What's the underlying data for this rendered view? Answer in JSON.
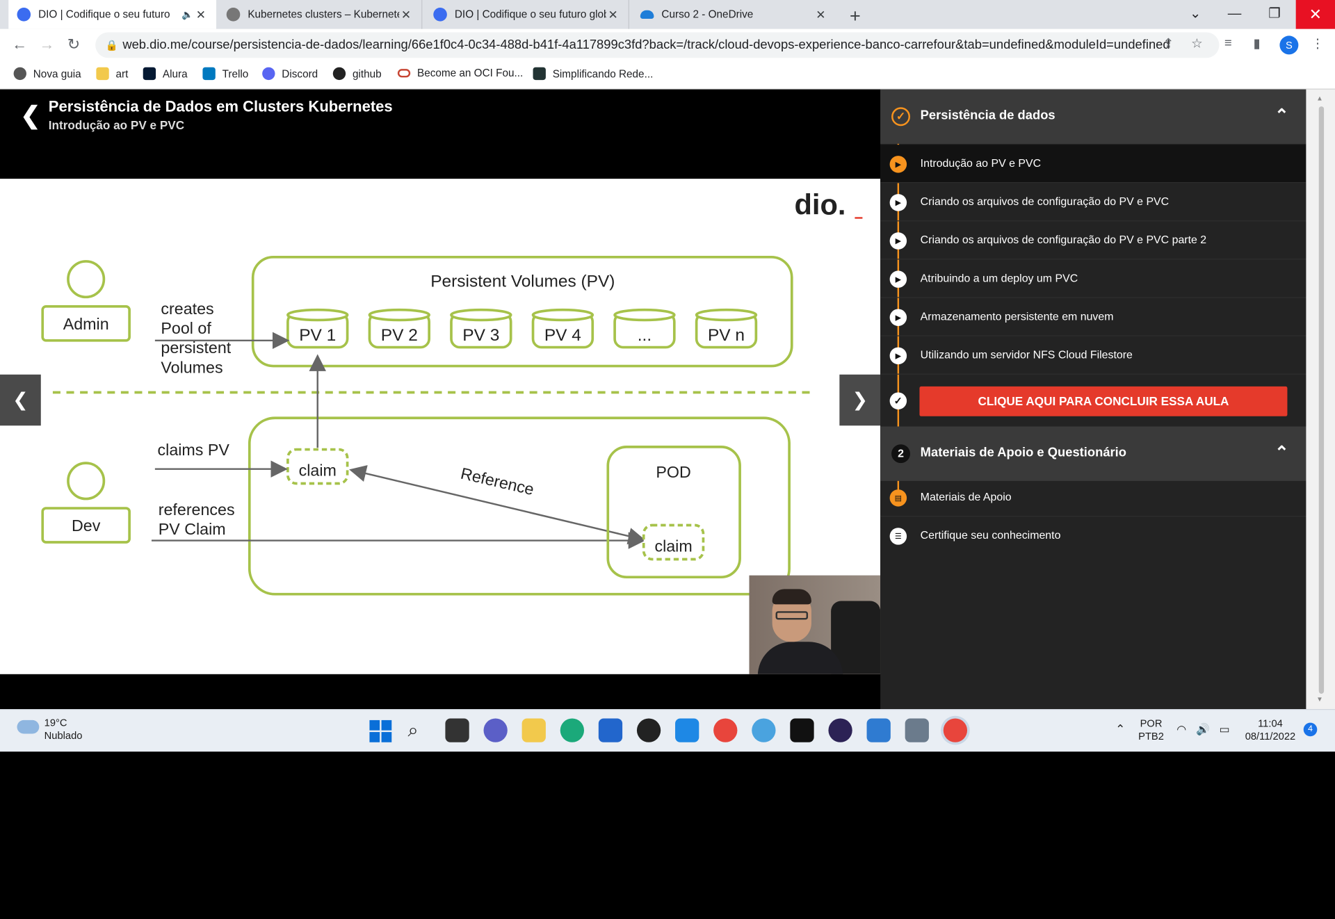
{
  "browser": {
    "tabs": [
      {
        "title": "DIO | Codifique o seu futuro",
        "icon": "dio-favicon",
        "active": true
      },
      {
        "title": "Kubernetes clusters – Kubernetes",
        "icon": "gear-favicon"
      },
      {
        "title": "DIO | Codifique o seu futuro glob",
        "icon": "dio-favicon"
      },
      {
        "title": "Curso 2 - OneDrive",
        "icon": "onedrive-favicon"
      }
    ],
    "url": "web.dio.me/course/persistencia-de-dados/learning/66e1f0c4-0c34-488d-b41f-4a117899c3fd?back=/track/cloud-devops-experience-banco-carrefour&tab=undefined&moduleId=undefined",
    "profile_initial": "S",
    "bookmarks": [
      "Nova guia",
      "art",
      "Alura",
      "Trello",
      "Discord",
      "github",
      "Become an OCI Fou...",
      "Simplificando Rede..."
    ]
  },
  "course": {
    "title": "Persistência de Dados em Clusters Kubernetes",
    "lesson": "Introdução ao PV e PVC"
  },
  "slide": {
    "logo": "dio.",
    "top_box_title": "Persistent Volumes (PV)",
    "pvs": [
      "PV 1",
      "PV 2",
      "PV 3",
      "PV 4",
      "...",
      "PV n"
    ],
    "admin": "Admin",
    "admin_text": [
      "creates",
      "Pool of",
      "persistent",
      "Volumes"
    ],
    "dev": "Dev",
    "claims_text": "claims PV",
    "references_text": [
      "references",
      "PV Claim"
    ],
    "claim": "claim",
    "reference": "Reference",
    "pod": "POD",
    "pod_claim": "claim"
  },
  "sidebar": {
    "section1": "Persistência de dados",
    "items": [
      "Introdução ao PV e PVC",
      "Criando os arquivos de configuração do PV e PVC",
      "Criando os arquivos de configuração do PV e PVC parte 2",
      "Atribuindo a um deploy um PVC",
      "Armazenamento persistente em nuvem",
      "Utilizando um servidor NFS Cloud Filestore"
    ],
    "finish_button": "CLIQUE AQUI PARA CONCLUIR ESSA AULA",
    "section2_number": "2",
    "section2": "Materiais de Apoio e Questionário",
    "items2": [
      "Materiais de Apoio",
      "Certifique seu conhecimento"
    ]
  },
  "taskbar": {
    "temperature": "19°C",
    "weather": "Nublado",
    "language": "POR",
    "layout": "PTB2",
    "time": "11:04",
    "date": "08/11/2022",
    "notifications": "4"
  },
  "colors": {
    "accent": "#f7931e",
    "finish": "#e53a2b",
    "slide_green": "#a6c24a"
  }
}
